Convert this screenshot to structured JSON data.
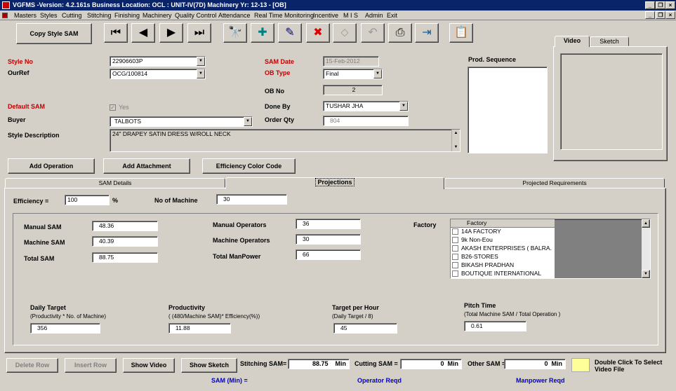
{
  "window": {
    "title": "VGFMS -Version: 4.2.161s Business Location: OCL : UNIT-IV(7D)   Machinery Yr: 12-13  - [OB]"
  },
  "menu": [
    "Masters",
    "Styles",
    "Cutting",
    "Stitching",
    "Finishing",
    "Machinery",
    "Quality Control",
    "Attendance",
    "Real Time Monitoring",
    "Incentive",
    "M I S",
    "Admin",
    "Exit"
  ],
  "toolbar": {
    "copy_label": "Copy Style SAM",
    "icons": [
      "first-record-icon",
      "prev-record-icon",
      "next-record-icon",
      "last-record-icon",
      "binoculars-icon",
      "add-icon",
      "edit-icon",
      "delete-icon",
      "eraser-icon",
      "undo-icon",
      "print-icon",
      "exit-icon",
      "notepad-icon"
    ],
    "glyphs": [
      "⏮",
      "◀",
      "▶",
      "⏭",
      "🔭",
      "✚",
      "✎",
      "✖",
      "⬦",
      "↶",
      "⎙",
      "⇥",
      "📋"
    ]
  },
  "form": {
    "style_no_label": "Style No",
    "style_no": "22906603P",
    "ourref_label": "OurRef",
    "ourref": "OCG/100814",
    "default_sam_label": "Default SAM",
    "default_sam_value": "Yes",
    "buyer_label": "Buyer",
    "buyer": "TALBOTS",
    "style_desc_label": "Style Description",
    "style_desc": "24\" DRAPEY SATIN DRESS W/ROLL NECK",
    "sam_date_label": "SAM Date",
    "sam_date": "15-Feb-2012",
    "ob_type_label": "OB Type",
    "ob_type": "Final",
    "ob_no_label": "OB No",
    "ob_no": "2",
    "done_by_label": "Done By",
    "done_by": "TUSHAR JHA",
    "order_qty_label": "Order Qty",
    "order_qty": "804",
    "prod_seq_label": "Prod. Sequence"
  },
  "media_tabs": [
    "Video",
    "Sketch"
  ],
  "buttons": {
    "add_operation": "Add Operation",
    "add_attachment": "Add Attachment",
    "efficiency_color": "Efficiency Color Code"
  },
  "main_tabs": [
    "SAM Details",
    "Projections",
    "Projected Requirements"
  ],
  "projections": {
    "efficiency_label": "Efficiency =",
    "efficiency": "100",
    "percent": "%",
    "no_machine_label": "No of Machine",
    "no_machine": "30",
    "manual_sam_label": "Manual SAM",
    "manual_sam": "48.36",
    "machine_sam_label": "Machine SAM",
    "machine_sam": "40.39",
    "total_sam_label": "Total SAM",
    "total_sam": "88.75",
    "manual_ops_label": "Manual Operators",
    "manual_ops": "36",
    "machine_ops_label": "Machine Operators",
    "machine_ops": "30",
    "total_manpower_label": "Total ManPower",
    "total_manpower": "66",
    "factory_label": "Factory",
    "factory_header": "Factory",
    "factories": [
      "14A FACTORY",
      "9k Non-Eou",
      "AKASH ENTERPRISES ( BALRA.",
      "B26-STORES",
      "BIKASH PRADHAN",
      "BOUTIQUE INTERNATIONAL"
    ],
    "daily_target_label": "Daily Target",
    "daily_target_formula": "(Productivity * No. of Machine)",
    "daily_target": "356",
    "productivity_label": "Productivity",
    "productivity_formula": "( (480/Machine SAM)* Efficiency(%))",
    "productivity": "11.88",
    "target_hour_label": "Target per Hour",
    "target_hour_formula": "(Daily Target / 8)",
    "target_hour": "45",
    "pitch_time_label": "Pitch Time",
    "pitch_time_formula": "(Total Machine SAM / Total Operation )",
    "pitch_time": "0.61"
  },
  "bottom": {
    "delete_row": "Delete Row",
    "insert_row": "Insert Row",
    "show_video": "Show Video",
    "show_sketch": "Show Sketch",
    "stitching_sam_label": "Stitching SAM=",
    "stitching_sam": "88.75",
    "min1": "Min",
    "cutting_sam_label": "Cutting SAM =",
    "cutting_sam": "0",
    "min2": "Min",
    "other_sam_label": "Other SAM =",
    "other_sam": "0",
    "min3": "Min",
    "dbl_click": "Double Click To Select Video File",
    "sam_min": "SAM (Min) =",
    "operator_reqd": "Operator Reqd",
    "manpower_reqd": "Manpower Reqd"
  },
  "colors": {
    "titlebar": "#0a246a",
    "label_red": "#c00000",
    "label_blue": "#0000c0",
    "video_swatch": "#ffff99"
  }
}
